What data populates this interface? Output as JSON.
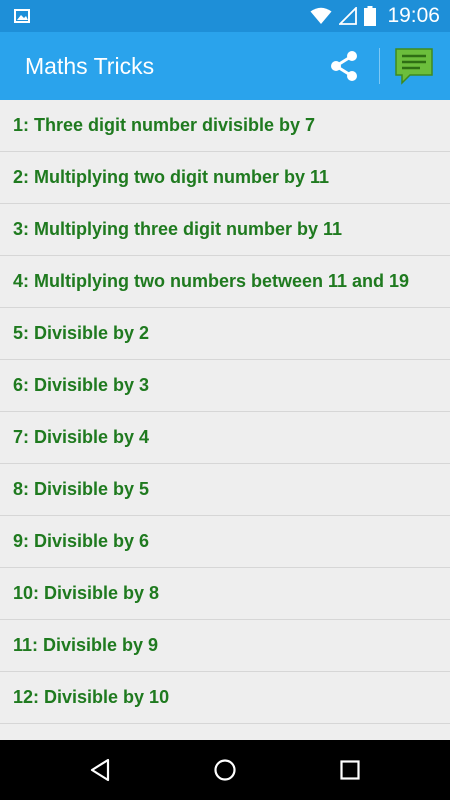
{
  "status_bar": {
    "time": "19:06",
    "icons": [
      "image-icon",
      "wifi-icon",
      "signal-icon",
      "battery-icon"
    ]
  },
  "app_bar": {
    "title": "Maths Tricks",
    "actions": [
      "share-icon",
      "feedback-icon"
    ],
    "feedback_color": "#6cbe3c"
  },
  "list": {
    "items": [
      {
        "label": "1: Three digit number divisible by 7"
      },
      {
        "label": "2: Multiplying two digit number by 11"
      },
      {
        "label": "3: Multiplying three digit number by 11"
      },
      {
        "label": "4: Multiplying two numbers between 11 and 19"
      },
      {
        "label": "5: Divisible by 2"
      },
      {
        "label": "6: Divisible by 3"
      },
      {
        "label": "7: Divisible by 4"
      },
      {
        "label": "8: Divisible by 5"
      },
      {
        "label": "9: Divisible by 6"
      },
      {
        "label": "10: Divisible by 8"
      },
      {
        "label": "11: Divisible by 9"
      },
      {
        "label": "12: Divisible by 10"
      }
    ],
    "text_color": "#1f7a1f"
  },
  "nav_bar": {
    "buttons": [
      "back-icon",
      "home-icon",
      "recents-icon"
    ]
  }
}
